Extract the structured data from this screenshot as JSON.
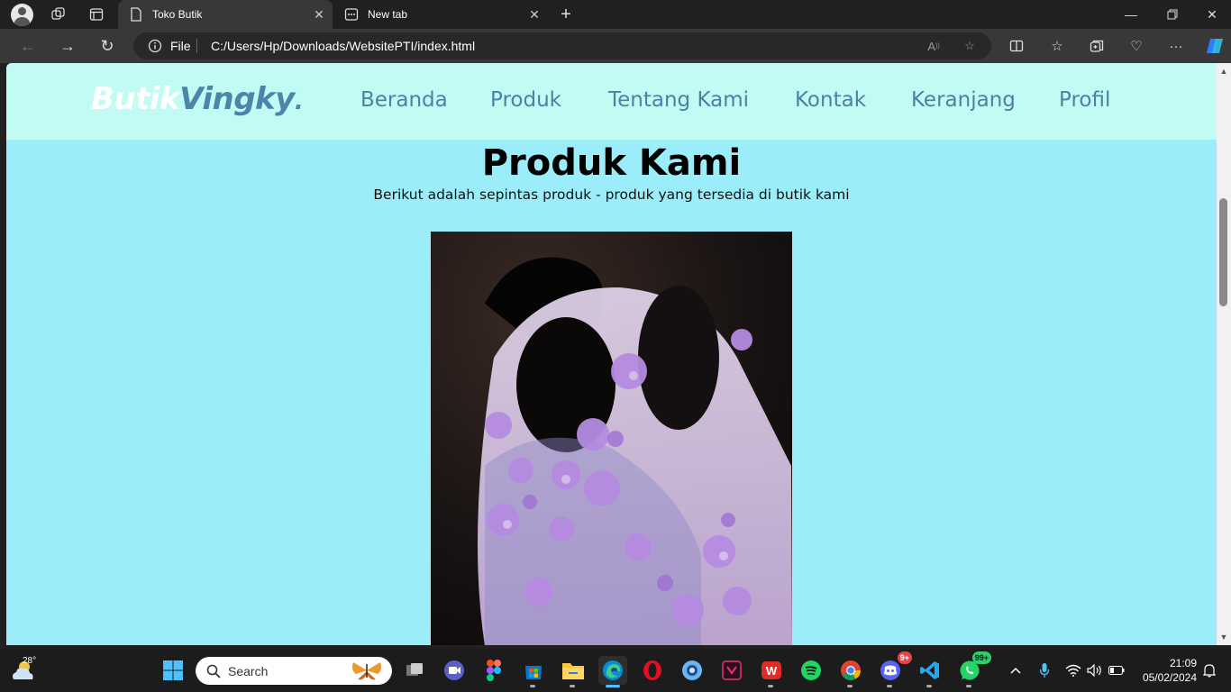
{
  "browser": {
    "tabs": [
      {
        "title": "Toko Butik",
        "active": true
      },
      {
        "title": "New tab",
        "active": false
      }
    ],
    "address": {
      "scheme": "File",
      "url": "C:/Users/Hp/Downloads/WebsitePTI/index.html"
    }
  },
  "site": {
    "logo": {
      "part1": "Butik",
      "part2": "Vingky",
      "suffix": "."
    },
    "menu": [
      "Beranda",
      "Produk",
      "Tentang Kami",
      "Kontak",
      "Keranjang",
      "Profil"
    ],
    "heading": "Produk Kami",
    "subheading": "Berikut adalah sepintas produk - produk yang tersedia di butik kami",
    "colors": {
      "nav_bg": "#c1fbf3",
      "page_bg": "#9beef9",
      "menu_text": "#4a82a5"
    }
  },
  "taskbar": {
    "weather_temp": "28°",
    "search_label": "Search",
    "badges": {
      "discord": "9+",
      "whatsapp": "99+"
    },
    "time": "21:09",
    "date": "05/02/2024"
  }
}
